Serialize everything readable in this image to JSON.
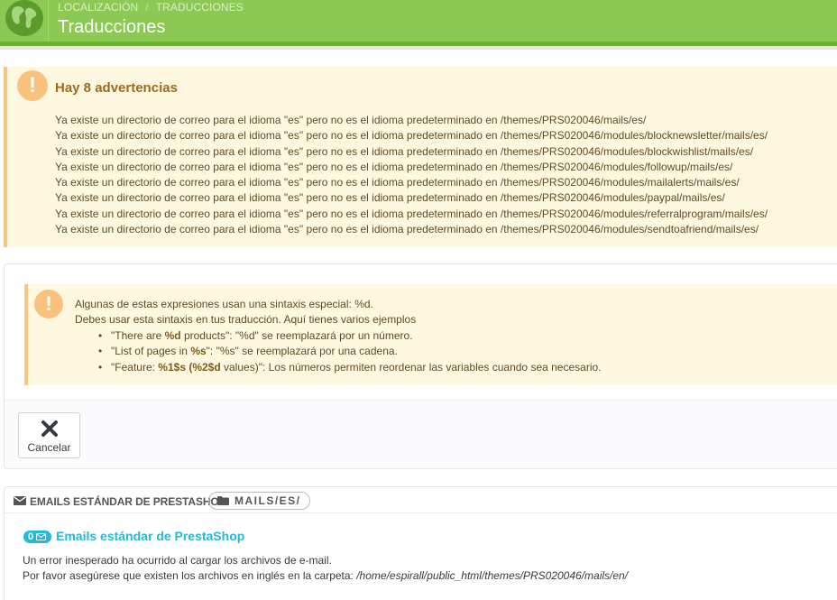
{
  "header": {
    "breadcrumb": [
      "LOCALIZACIÓN",
      "TRADUCCIONES"
    ],
    "breadcrumb_separator": "/",
    "title": "Traducciones",
    "icon": "globe-icon",
    "accent_color": "#8bc954"
  },
  "warnings": {
    "icon": "exclamation-icon",
    "title": "Hay 8 advertencias",
    "items": [
      "Ya existe un directorio de correo para el idioma \"es\" pero no es el idioma predeterminado en /themes/PRS020046/mails/es/",
      "Ya existe un directorio de correo para el idioma \"es\" pero no es el idioma predeterminado en /themes/PRS020046/modules/blocknewsletter/mails/es/",
      "Ya existe un directorio de correo para el idioma \"es\" pero no es el idioma predeterminado en /themes/PRS020046/modules/blockwishlist/mails/es/",
      "Ya existe un directorio de correo para el idioma \"es\" pero no es el idioma predeterminado en /themes/PRS020046/modules/followup/mails/es/",
      "Ya existe un directorio de correo para el idioma \"es\" pero no es el idioma predeterminado en /themes/PRS020046/modules/mailalerts/mails/es/",
      "Ya existe un directorio de correo para el idioma \"es\" pero no es el idioma predeterminado en /themes/PRS020046/modules/paypal/mails/es/",
      "Ya existe un directorio de correo para el idioma \"es\" pero no es el idioma predeterminado en /themes/PRS020046/modules/referralprogram/mails/es/",
      "Ya existe un directorio de correo para el idioma \"es\" pero no es el idioma predeterminado en /themes/PRS020046/modules/sendtoafriend/mails/es/"
    ],
    "color": "#f6c781"
  },
  "syntax_info": {
    "line1": "Algunas de estas expresiones usan una sintaxis especial: %d.",
    "line2": "Debes usar esta sintaxis en tus traducción. Aquí tienes varios ejemplos",
    "examples": [
      {
        "pre": "\"There are ",
        "bold": "%d",
        "post": " products\": \"%d\" se reemplazará por un número."
      },
      {
        "pre": "\"List of pages in ",
        "bold": "%s",
        "post": "\": \"%s\" se reemplazará por una cadena."
      },
      {
        "pre": "\"Feature: ",
        "bold": "%1$s (%2$d",
        "post": " values)\": Los números permiten reordenar las variables cuando sea necesario."
      }
    ]
  },
  "actions": {
    "cancel_label": "Cancelar",
    "cancel_icon": "close-icon"
  },
  "emails_panel": {
    "title": "EMAILS ESTÁNDAR DE PRESTASHOP",
    "title_icon": "envelope-icon",
    "path_badge": "MAILS/ES/",
    "path_icon": "folder-icon",
    "count": "0",
    "section_link": "Emails estándar de PrestaShop",
    "error_line1": "Un error inesperado ha ocurrido al cargar los archivos de e-mail.",
    "error_line2_prefix": "Por favor asegúrese que existen los archivos en inglés en la carpeta: ",
    "error_line2_path": "/home/espirall/public_html/themes/PRS020046/mails/en/",
    "link_color": "#25b9d7"
  }
}
